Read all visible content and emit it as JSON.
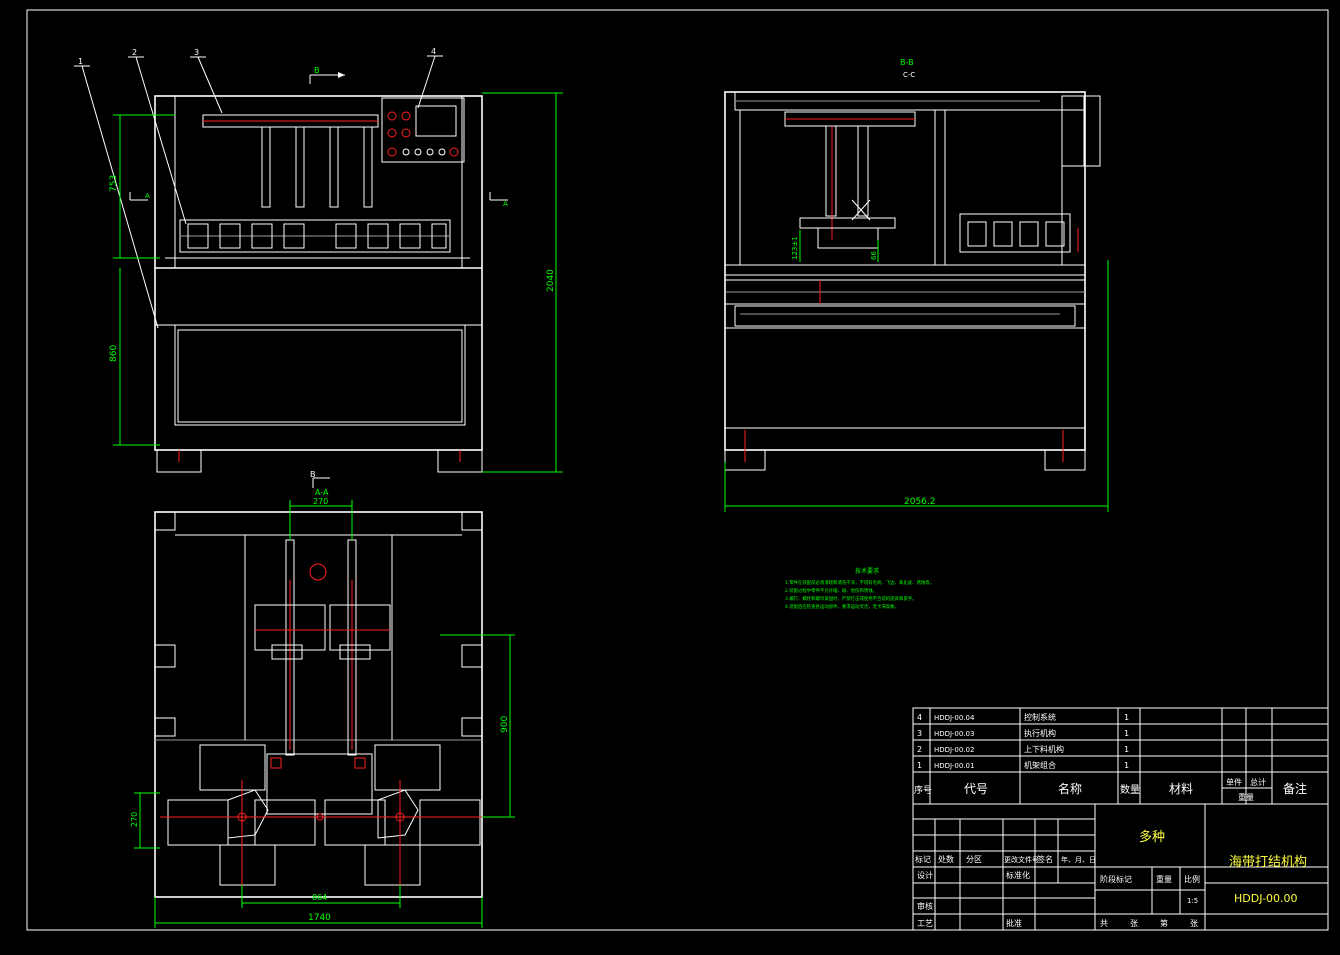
{
  "drawing": {
    "section_labels": {
      "b_top": "B",
      "b_bottom": "B",
      "a_left": "A",
      "a_right": "A",
      "section_aa": "A-A",
      "section_bb": "B-B",
      "section_cc": "C-C"
    },
    "part_callouts": [
      "1",
      "2",
      "3",
      "4"
    ],
    "dimensions": {
      "front_upper_height": "753",
      "front_lower_height": "860",
      "front_total_height": "2040",
      "side_total_width": "2056.2",
      "side_small_a": "123±1",
      "side_small_b": "66",
      "plan_top_width": "270",
      "plan_right_height": "900",
      "plan_left_height": "270",
      "plan_bottom_inner": "864",
      "plan_bottom_total": "1740"
    },
    "tech_requirements": {
      "title": "技术要求",
      "lines": [
        "1.零件在装配前必须清理和清洗干净，不得有毛刺、飞边、氧化皮、锈蚀等。",
        "2.装配过程中零件不允许磕、碰、划伤和锈蚀。",
        "3.螺钉、螺栓和螺母紧固时，严禁打击或使用不合适的旋具和扳手。",
        "4.装配后应检查各运动部件，要求运动灵活，无卡滞现象。"
      ]
    }
  },
  "bom": {
    "rows": [
      {
        "no": "4",
        "code": "HDDJ-00.04",
        "name": "控制系统",
        "qty": "1"
      },
      {
        "no": "3",
        "code": "HDDJ-00.03",
        "name": "执行机构",
        "qty": "1"
      },
      {
        "no": "2",
        "code": "HDDJ-00.02",
        "name": "上下料机构",
        "qty": "1"
      },
      {
        "no": "1",
        "code": "HDDJ-00.01",
        "name": "机架组合",
        "qty": "1"
      }
    ],
    "headers": {
      "no": "序号",
      "code": "代号",
      "name": "名称",
      "qty": "数量",
      "material": "材料",
      "single": "单件",
      "total": "总计",
      "weight": "重量",
      "remark": "备注"
    }
  },
  "title_block": {
    "material": "多种",
    "title": "海带打结机构",
    "drawing_no": "HDDJ-00.00",
    "scale": "1:5",
    "rev_labels": [
      "标记",
      "处数",
      "分区",
      "更改文件号",
      "签名",
      "年、月、日"
    ],
    "design": "设计",
    "standardize": "标准化",
    "stage_mark": "阶段标记",
    "weight_label": "重量",
    "scale_label": "比例",
    "review": "审核",
    "process": "工艺",
    "approve": "批准",
    "sheets": [
      "共",
      "张",
      "第",
      "张"
    ]
  }
}
